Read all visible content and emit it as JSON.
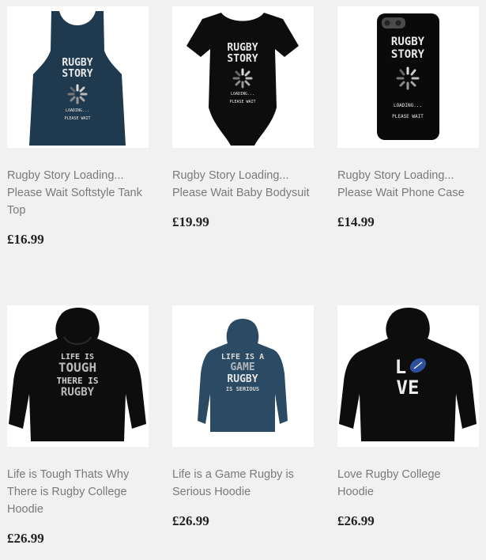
{
  "products": [
    {
      "title": "Rugby Story Loading... Please Wait Softstyle Tank Top",
      "price": "£16.99",
      "print": {
        "line1": "RUGBY",
        "line2": "STORY",
        "line3": "LOADING...",
        "line4": "PLEASE WAIT"
      }
    },
    {
      "title": "Rugby Story Loading... Please Wait Baby Bodysuit",
      "price": "£19.99",
      "print": {
        "line1": "RUGBY",
        "line2": "STORY",
        "line3": "LOADING...",
        "line4": "PLEASE WAIT"
      }
    },
    {
      "title": "Rugby Story Loading... Please Wait Phone Case",
      "price": "£14.99",
      "print": {
        "line1": "RUGBY",
        "line2": "STORY",
        "line3": "LOADING...",
        "line4": "PLEASE WAIT"
      }
    },
    {
      "title": "Life is Tough Thats Why There is Rugby College Hoodie",
      "price": "£26.99",
      "print": {
        "line1": "LIFE IS",
        "line2": "TOUGH",
        "line3": "THERE IS",
        "line4": "RUGBY"
      }
    },
    {
      "title": "Life is a Game Rugby is Serious Hoodie",
      "price": "£26.99",
      "print": {
        "line1": "LIFE IS A",
        "line2": "GAME",
        "line3": "RUGBY",
        "line4": "IS SERIOUS"
      }
    },
    {
      "title": "Love Rugby College Hoodie",
      "price": "£26.99",
      "print": {
        "line1": "L",
        "line2": "VE"
      }
    }
  ],
  "colors": {
    "background": "#f1f1f1",
    "title": "#7a7a7a",
    "price": "#222222",
    "navy": "#1f3a4f",
    "black": "#0d0d0d"
  }
}
